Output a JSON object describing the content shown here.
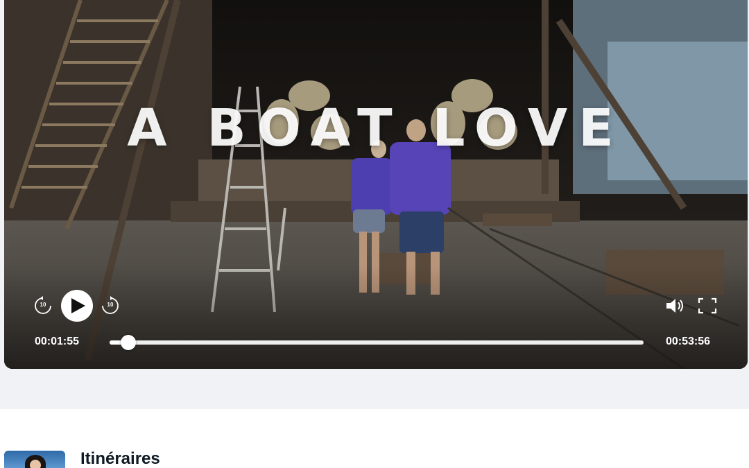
{
  "video": {
    "title_overlay": "A BOAT LOVE",
    "current_time": "00:01:55",
    "total_time": "00:53:56",
    "progress_fraction": 0.0355,
    "skip_back_seconds": "10",
    "skip_forward_seconds": "10"
  },
  "controls": {
    "play_icon": "play-icon",
    "skip_back_icon": "rewind-10-icon",
    "skip_forward_icon": "forward-10-icon",
    "volume_icon": "volume-icon",
    "fullscreen_icon": "fullscreen-icon"
  },
  "program": {
    "show_title": "Itinéraires"
  },
  "colors": {
    "page_background": "#f0f2f5",
    "controls": "#ffffff"
  }
}
